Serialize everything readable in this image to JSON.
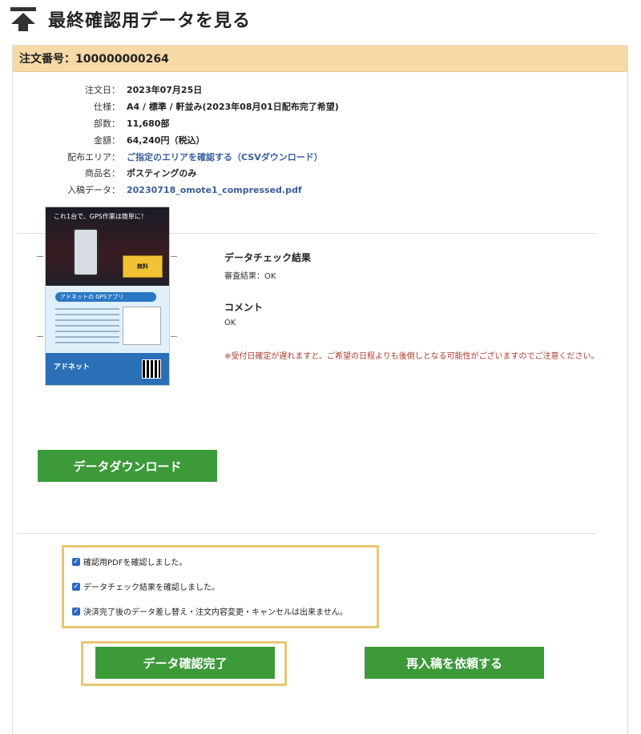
{
  "header": {
    "title": "最終確認用データを見る",
    "icon": "up-arrow-icon"
  },
  "order": {
    "label": "注文番号：100000000264"
  },
  "details": [
    {
      "label": "注文日：",
      "value": "2023年07月25日",
      "link": false
    },
    {
      "label": "仕様：",
      "value": "A4 / 標準 / 軒並み(2023年08月01日配布完了希望)",
      "link": false
    },
    {
      "label": "部数：",
      "value": "11,680部",
      "link": false
    },
    {
      "label": "金額：",
      "value": "64,240円（税込）",
      "link": false
    },
    {
      "label": "配布エリア：",
      "value": "ご指定のエリアを確認する（CSVダウンロード）",
      "link": true
    },
    {
      "label": "商品名：",
      "value": "ポスティングのみ",
      "link": false
    },
    {
      "label": "入稿データ：",
      "value": "20230718_omote1_compressed.pdf",
      "link": true
    }
  ],
  "thumbnail": {
    "headline": "これ1台で、GPS作業は簡単に！",
    "badge": "無料",
    "pill": "アドネットの GPSアプリ",
    "logo": "アドネット"
  },
  "download_button": "データダウンロード",
  "check_result": {
    "title": "データチェック結果",
    "value": "審査結果：OK"
  },
  "comment": {
    "title": "コメント",
    "value": "OK"
  },
  "warning": "※受付日確定が遅れますと、ご希望の日程よりも後倒しとなる可能性がございますのでご注意ください。",
  "checkboxes": [
    {
      "label": "確認用PDFを確認しました。",
      "checked": true
    },
    {
      "label": "データチェック結果を確認しました。",
      "checked": true
    },
    {
      "label": "決済完了後のデータ差し替え・注文内容変更・キャンセルは出来ません。",
      "checked": true
    }
  ],
  "buttons": {
    "confirm": "データ確認完了",
    "resubmit": "再入稿を依頼する"
  },
  "colors": {
    "accent": "#3c9a39",
    "order_bar": "#f5d9a6",
    "highlight": "#e6c873",
    "link": "#3a5e9c",
    "warning": "#b03a2e"
  }
}
